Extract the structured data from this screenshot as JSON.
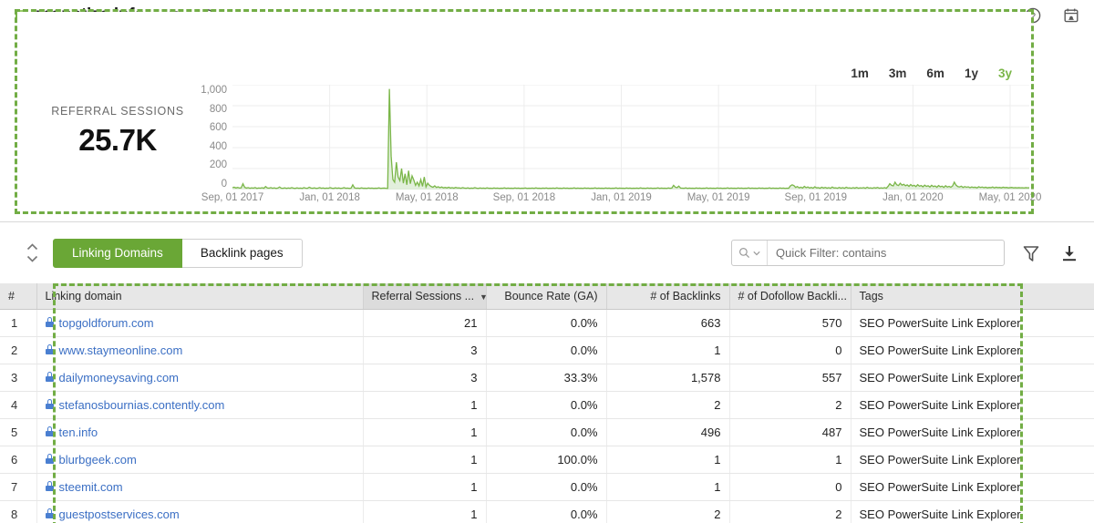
{
  "titlebar": {
    "site": "monetize.info",
    "favicon_icon": "monetize-favicon",
    "chart_icon": "bar-chart-icon",
    "refresh_icon": "refresh-icon",
    "help_icon": "help-circle-icon",
    "schedule_icon": "calendar-alarm-icon"
  },
  "kpi": {
    "label": "REFERRAL SESSIONS",
    "value": "25.7K"
  },
  "ranges": [
    {
      "label": "1m",
      "active": false
    },
    {
      "label": "3m",
      "active": false
    },
    {
      "label": "6m",
      "active": false
    },
    {
      "label": "1y",
      "active": false
    },
    {
      "label": "3y",
      "active": true
    }
  ],
  "toolbar": {
    "collapse_icon": "chevron-up-down-icon",
    "tabs": [
      {
        "label": "Linking Domains",
        "active": true
      },
      {
        "label": "Backlink pages",
        "active": false
      }
    ],
    "filter_mode_icon": "search-icon",
    "filter_mode_chevron": "chevron-down-icon",
    "filter_placeholder": "Quick Filter: contains",
    "filter_value": "",
    "funnel_icon": "funnel-filter-icon",
    "export_icon": "download-icon"
  },
  "table": {
    "headers": [
      {
        "label": "#",
        "align": "left",
        "sorted": false
      },
      {
        "label": "Linking domain",
        "align": "left",
        "sorted": false
      },
      {
        "label": "Referral Sessions ...",
        "align": "right",
        "sorted": true
      },
      {
        "label": "Bounce Rate (GA)",
        "align": "right",
        "sorted": false
      },
      {
        "label": "# of Backlinks",
        "align": "right",
        "sorted": false
      },
      {
        "label": "# of Dofollow Backli...",
        "align": "right",
        "sorted": false
      },
      {
        "label": "Tags",
        "align": "left",
        "sorted": false
      }
    ],
    "sort_arrow_icon": "sort-descending-arrow-icon",
    "rows": [
      {
        "idx": "1",
        "domain": "topgoldforum.com",
        "referral": "21",
        "bounce": "0.0%",
        "backlinks": "663",
        "dofollow": "570",
        "tags": "SEO PowerSuite Link Explorer"
      },
      {
        "idx": "2",
        "domain": "www.staymeonline.com",
        "referral": "3",
        "bounce": "0.0%",
        "backlinks": "1",
        "dofollow": "0",
        "tags": "SEO PowerSuite Link Explorer"
      },
      {
        "idx": "3",
        "domain": "dailymoneysaving.com",
        "referral": "3",
        "bounce": "33.3%",
        "backlinks": "1,578",
        "dofollow": "557",
        "tags": "SEO PowerSuite Link Explorer"
      },
      {
        "idx": "4",
        "domain": "stefanosbournias.contently.com",
        "referral": "1",
        "bounce": "0.0%",
        "backlinks": "2",
        "dofollow": "2",
        "tags": "SEO PowerSuite Link Explorer"
      },
      {
        "idx": "5",
        "domain": "ten.info",
        "referral": "1",
        "bounce": "0.0%",
        "backlinks": "496",
        "dofollow": "487",
        "tags": "SEO PowerSuite Link Explorer"
      },
      {
        "idx": "6",
        "domain": "blurbgeek.com",
        "referral": "1",
        "bounce": "100.0%",
        "backlinks": "1",
        "dofollow": "1",
        "tags": "SEO PowerSuite Link Explorer"
      },
      {
        "idx": "7",
        "domain": "steemit.com",
        "referral": "1",
        "bounce": "0.0%",
        "backlinks": "1",
        "dofollow": "0",
        "tags": "SEO PowerSuite Link Explorer"
      },
      {
        "idx": "8",
        "domain": "guestpostservices.com",
        "referral": "1",
        "bounce": "0.0%",
        "backlinks": "2",
        "dofollow": "2",
        "tags": "SEO PowerSuite Link Explorer"
      }
    ]
  },
  "colors": {
    "accent_green": "#7ab648",
    "tab_green": "#6aa736",
    "link_blue": "#3b6fc4",
    "highlight_dash": "#72ad45"
  },
  "chart_data": {
    "type": "area",
    "title": "",
    "xlabel": "",
    "ylabel": "",
    "ylim": [
      0,
      1000
    ],
    "yticks": [
      "0",
      "200",
      "400",
      "600",
      "800",
      "1,000"
    ],
    "grid": true,
    "legend": "none",
    "line_color": "#7ab648",
    "fill_color": "#d8ead0",
    "x_tick_labels": [
      "Sep, 01 2017",
      "Jan, 01 2018",
      "May, 01 2018",
      "Sep, 01 2018",
      "Jan, 01 2019",
      "May, 01 2019",
      "Sep, 01 2019",
      "Jan, 01 2020",
      "May, 01 2020"
    ],
    "x_tick_positions": [
      0.0,
      0.122,
      0.244,
      0.366,
      0.488,
      0.61,
      0.732,
      0.854,
      0.976
    ],
    "series": [
      {
        "name": "Referral sessions",
        "values": [
          18,
          22,
          15,
          20,
          14,
          16,
          55,
          21,
          14,
          18,
          12,
          16,
          13,
          19,
          11,
          15,
          13,
          17,
          12,
          28,
          15,
          13,
          18,
          12,
          16,
          11,
          14,
          24,
          13,
          12,
          16,
          11,
          15,
          12,
          18,
          13,
          11,
          16,
          12,
          14,
          11,
          18,
          13,
          12,
          22,
          14,
          12,
          16,
          11,
          13,
          18,
          12,
          15,
          11,
          14,
          12,
          18,
          13,
          11,
          16,
          12,
          15,
          11,
          13,
          18,
          12,
          14,
          11,
          13,
          45,
          16,
          12,
          14,
          11,
          16,
          12,
          13,
          11,
          15,
          12,
          14,
          11,
          13,
          12,
          16,
          11,
          13,
          14,
          12,
          11,
          960,
          320,
          95,
          70,
          260,
          120,
          85,
          200,
          60,
          150,
          45,
          180,
          55,
          130,
          90,
          40,
          70,
          35,
          95,
          30,
          120,
          25,
          60,
          40,
          28,
          22,
          35,
          20,
          26,
          18,
          24,
          16,
          20,
          15,
          22,
          14,
          18,
          13,
          20,
          15,
          16,
          12,
          18,
          14,
          12,
          16,
          11,
          14,
          12,
          18,
          13,
          11,
          15,
          12,
          14,
          11,
          16,
          12,
          13,
          11,
          15,
          12,
          14,
          11,
          13,
          12,
          16,
          11,
          14,
          12,
          13,
          11,
          15,
          12,
          14,
          11,
          13,
          12,
          15,
          11,
          13,
          12,
          14,
          11,
          16,
          12,
          13,
          11,
          14,
          12,
          15,
          11,
          13,
          12,
          14,
          11,
          16,
          12,
          13,
          11,
          15,
          12,
          14,
          11,
          13,
          12,
          16,
          11,
          14,
          12,
          13,
          11,
          15,
          12,
          14,
          11,
          13,
          12,
          16,
          11,
          14,
          12,
          13,
          11,
          15,
          12,
          14,
          11,
          13,
          12,
          16,
          11,
          14,
          12,
          13,
          11,
          15,
          12,
          14,
          11,
          13,
          12,
          14,
          11,
          16,
          12,
          13,
          11,
          15,
          12,
          14,
          11,
          13,
          12,
          16,
          11,
          14,
          12,
          13,
          11,
          15,
          12,
          14,
          40,
          22,
          18,
          32,
          14,
          13,
          12,
          16,
          11,
          14,
          12,
          13,
          11,
          15,
          12,
          14,
          11,
          13,
          12,
          16,
          11,
          14,
          12,
          13,
          11,
          15,
          12,
          14,
          11,
          13,
          12,
          16,
          11,
          14,
          12,
          13,
          11,
          15,
          12,
          14,
          11,
          13,
          12,
          16,
          11,
          14,
          12,
          13,
          11,
          15,
          12,
          14,
          11,
          13,
          12,
          16,
          11,
          14,
          12,
          13,
          11,
          15,
          12,
          14,
          11,
          13,
          12,
          35,
          45,
          38,
          20,
          28,
          16,
          22,
          14,
          30,
          18,
          24,
          15,
          20,
          13,
          26,
          16,
          18,
          12,
          22,
          14,
          20,
          13,
          18,
          12,
          24,
          15,
          16,
          12,
          20,
          13,
          18,
          12,
          22,
          14,
          16,
          12,
          18,
          13,
          20,
          12,
          16,
          14,
          18,
          12,
          22,
          13,
          16,
          12,
          18,
          14,
          20,
          12,
          16,
          13,
          18,
          12,
          30,
          55,
          40,
          35,
          70,
          45,
          38,
          60,
          42,
          50,
          36,
          44,
          30,
          48,
          34,
          40,
          28,
          46,
          32,
          38,
          26,
          42,
          30,
          36,
          24,
          40,
          28,
          34,
          22,
          38,
          26,
          32,
          20,
          36,
          24,
          30,
          22,
          34,
          70,
          42,
          28,
          24,
          32,
          20,
          28,
          22,
          26,
          18,
          24,
          20,
          22,
          16,
          26,
          20,
          24,
          18,
          22,
          16,
          20,
          18,
          24,
          16,
          22,
          18,
          20,
          16,
          22,
          18,
          20,
          16,
          18,
          20,
          16,
          18,
          16,
          18,
          16,
          17,
          15,
          18,
          16,
          17
        ]
      }
    ]
  }
}
